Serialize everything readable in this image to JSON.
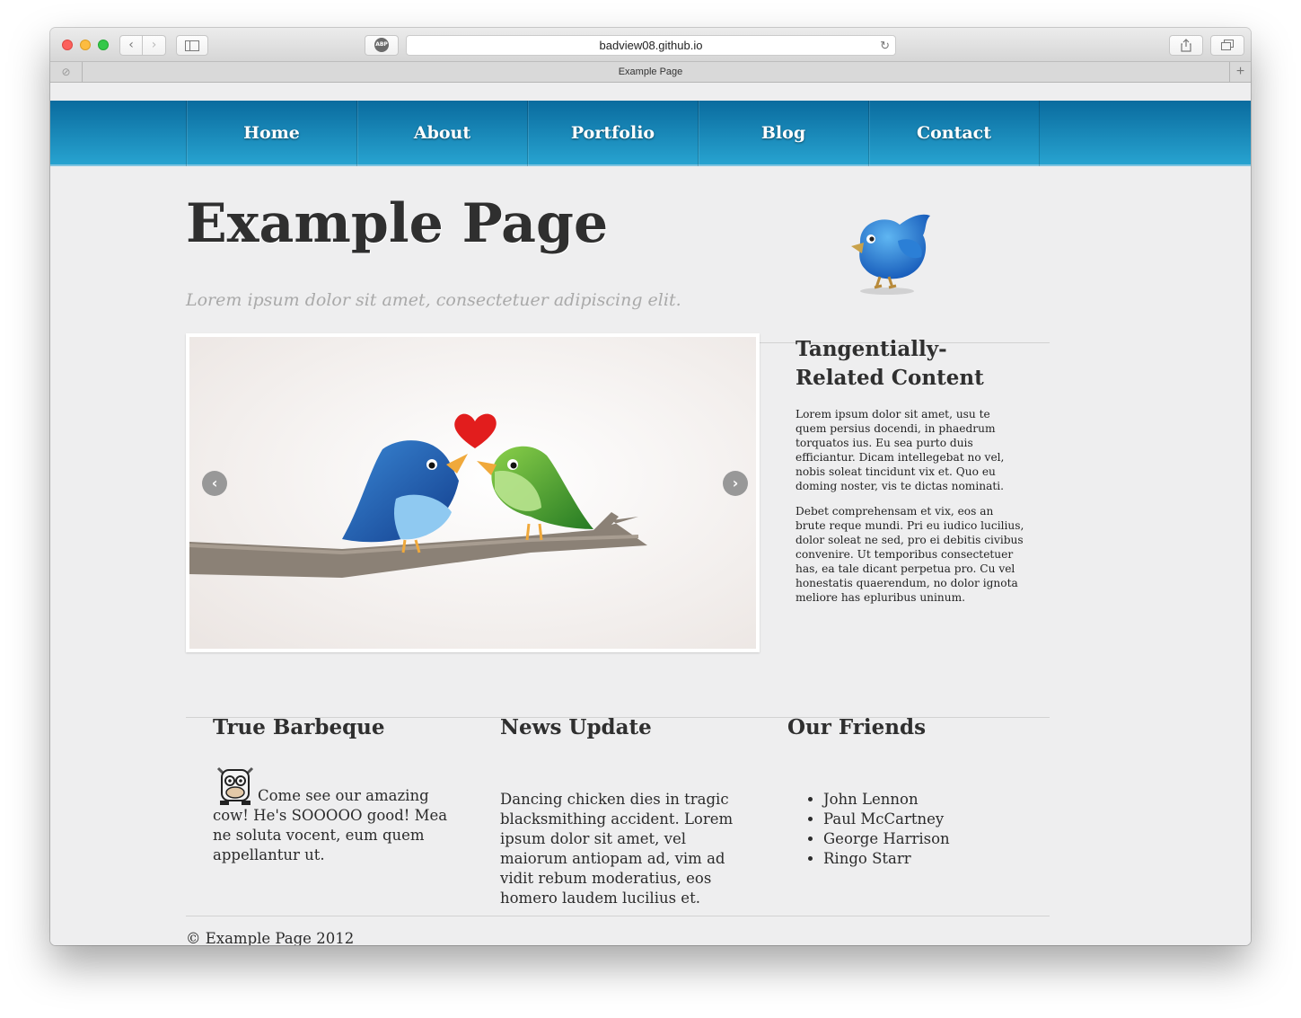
{
  "browser": {
    "url": "badview08.github.io",
    "tab_title": "Example Page",
    "back_icon": "‹",
    "forward_icon": "›",
    "reload_icon": "↻",
    "abp_label": "ABP",
    "plus_icon": "+"
  },
  "nav": {
    "items": [
      "Home",
      "About",
      "Portfolio",
      "Blog",
      "Contact"
    ]
  },
  "header": {
    "title": "Example Page",
    "tagline": "Lorem ipsum dolor sit amet, consectetuer adipiscing elit."
  },
  "slider": {
    "prev_icon": "‹",
    "next_icon": "›"
  },
  "aside": {
    "title": "Tangentially-Related Content",
    "paragraphs": [
      "Lorem ipsum dolor sit amet, usu te quem persius docendi, in phaedrum torquatos ius. Eu sea purto duis efficiantur. Dicam intellegebat no vel, nobis soleat tincidunt vix et. Quo eu doming noster, vis te dictas nominati.",
      "Debet comprehensam et vix, eos an brute reque mundi. Pri eu iudico lucilius, dolor soleat ne sed, pro ei debitis civibus convenire. Ut temporibus consectetuer has, ea tale dicant perpetua pro. Cu vel honestatis quaerendum, no dolor ignota meliore has epluribus uninum."
    ]
  },
  "columns": {
    "bbq": {
      "title": "True Barbeque",
      "text": "Come see our amazing cow! He's SOOOOO good! Mea ne soluta vocent, eum quem appellantur ut."
    },
    "news": {
      "title": "News Update",
      "text": "Dancing chicken dies in tragic blacksmithing accident. Lorem ipsum dolor sit amet, vel maiorum antiopam ad, vim ad vidit rebum moderatius, eos homero laudem lucilius et."
    },
    "friends": {
      "title": "Our Friends",
      "items": [
        "John Lennon",
        "Paul McCartney",
        "George Harrison",
        "Ringo Starr"
      ]
    }
  },
  "footer": {
    "text": "© Example Page 2012"
  },
  "colors": {
    "nav_top": "#0a6b9e",
    "nav_bottom": "#27a3d0",
    "page_bg": "#eeeeef"
  }
}
